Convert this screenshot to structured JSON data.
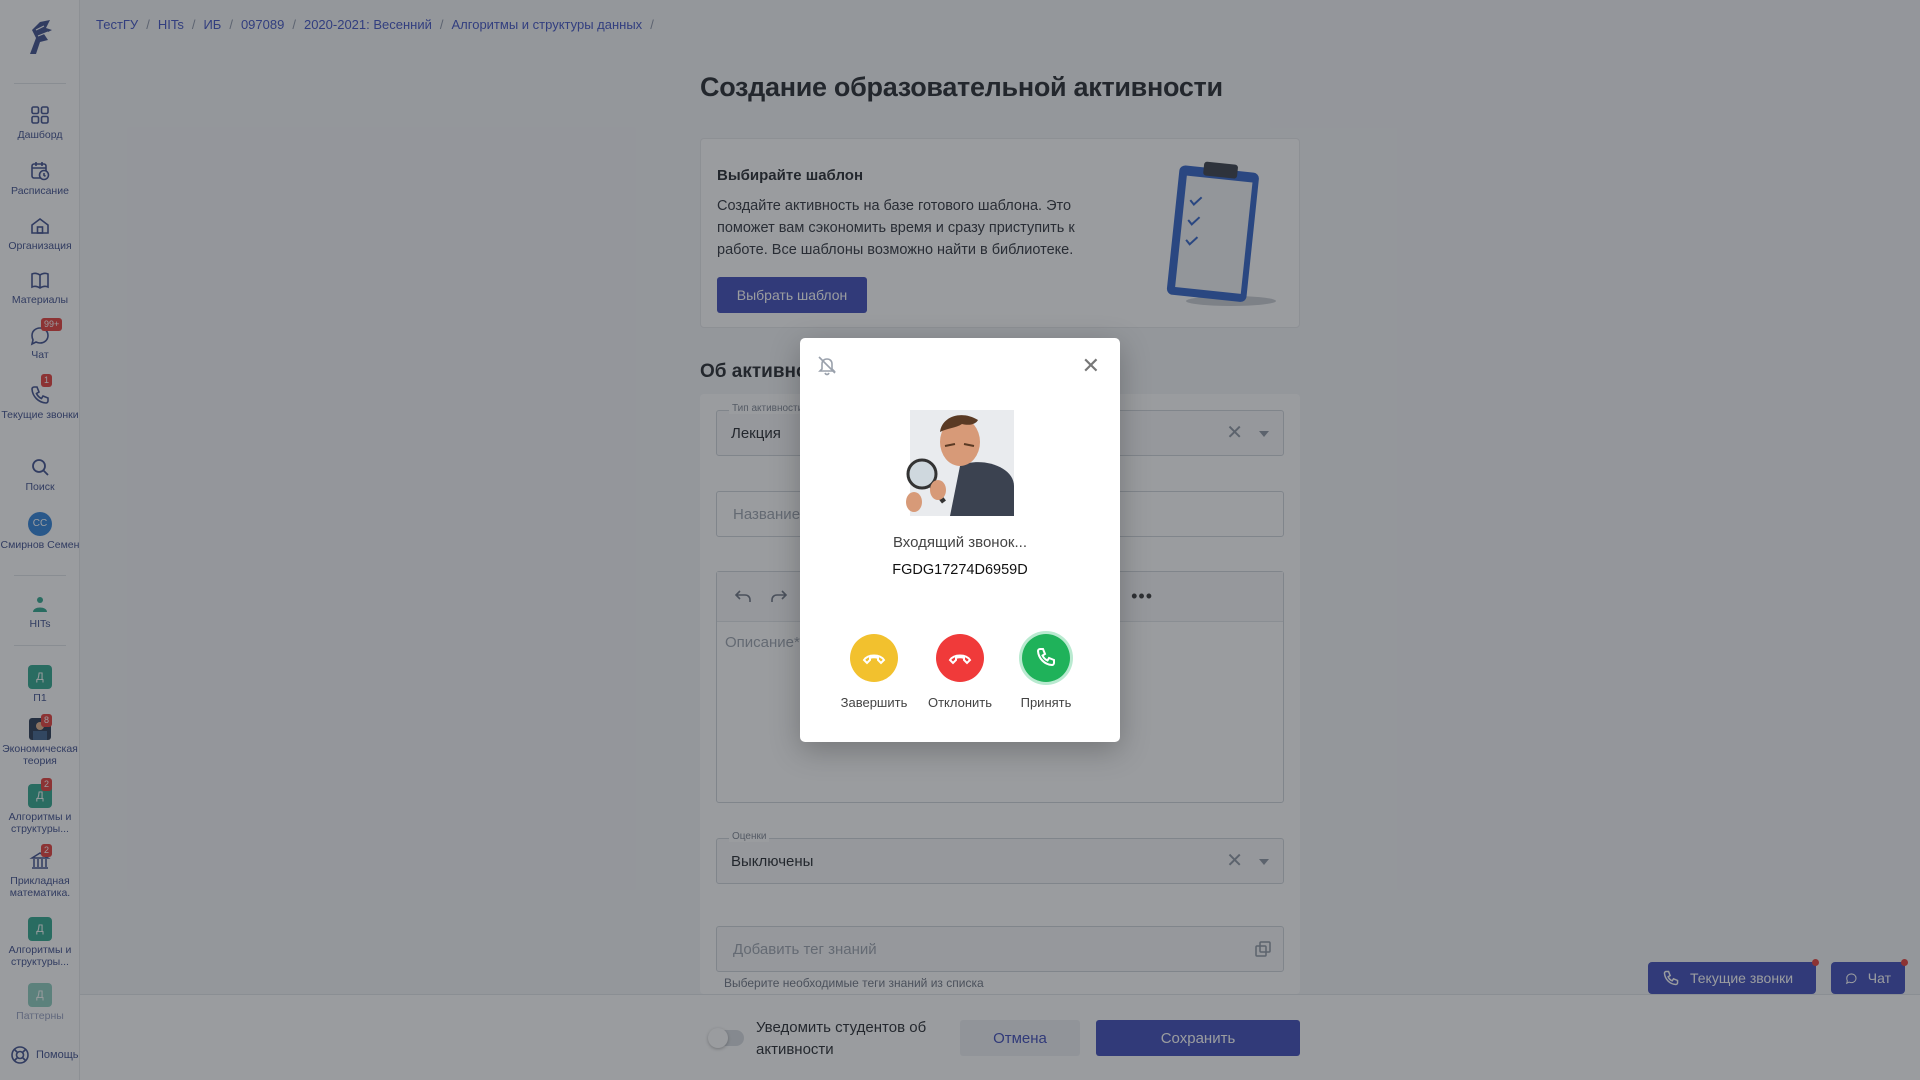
{
  "breadcrumb": [
    "ТестГУ",
    "HITs",
    "ИБ",
    "097089",
    "2020-2021: Весенний",
    "Алгоритмы и структуры данных"
  ],
  "sidebar": {
    "nav": [
      {
        "label": "Дашборд",
        "icon": "grid-icon"
      },
      {
        "label": "Расписание",
        "icon": "calendar-clock-icon"
      },
      {
        "label": "Организация",
        "icon": "building-icon"
      },
      {
        "label": "Материалы",
        "icon": "book-icon"
      },
      {
        "label": "Чат",
        "icon": "chat-icon",
        "badge": "99+"
      },
      {
        "label": "Текущие звонки",
        "icon": "phone-icon",
        "badge": "1"
      },
      {
        "label": "Поиск",
        "icon": "search-icon"
      }
    ],
    "user": {
      "initials": "СС",
      "name": "Смирнов Семен"
    },
    "org": {
      "label": "HITs"
    },
    "courses": [
      {
        "label": "П1",
        "letter": "Д"
      },
      {
        "label": "Экономическая теория",
        "badge": "8"
      },
      {
        "label": "Алгоритмы и структуры...",
        "letter": "Д",
        "badge": "2"
      },
      {
        "label": "Прикладная математика.",
        "badge": "2"
      },
      {
        "label": "Алгоритмы и структуры...",
        "letter": "Д"
      },
      {
        "label": "Паттерны",
        "letter": "Д"
      }
    ],
    "help": "Помощь"
  },
  "page": {
    "title": "Создание образовательной активности",
    "template_card": {
      "heading": "Выбирайте шаблон",
      "text": "Создайте активность на базе готового шаблона. Это поможет вам сэкономить время и сразу приступить к работе. Все шаблоны возможно найти в библиотеке.",
      "button": "Выбрать шаблон"
    },
    "section_heading": "Об активности",
    "type_field": {
      "label": "Тип активности",
      "value": "Лекция"
    },
    "name_field": {
      "placeholder": "Название*"
    },
    "description": {
      "placeholder": "Описание*"
    },
    "grades_field": {
      "label": "Оценки",
      "value": "Выключены"
    },
    "tags_field": {
      "placeholder": "Добавить тег знаний",
      "hint": "Выберите необходимые теги знаний из списка"
    }
  },
  "footer": {
    "notify_label": "Уведомить студентов об активности",
    "cancel": "Отмена",
    "save": "Сохранить"
  },
  "floating": {
    "calls": "Текущие звонки",
    "chat": "Чат"
  },
  "call_modal": {
    "status": "Входящий звонок...",
    "caller": "FGDG17274D6959D",
    "buttons": [
      {
        "label": "Завершить",
        "color": "#f2c12e"
      },
      {
        "label": "Отклонить",
        "color": "#f03a3a"
      },
      {
        "label": "Принять",
        "color": "#1fb25a"
      }
    ]
  },
  "colors": {
    "accent": "#3947b8",
    "sidebar_text": "#3a4a8a"
  }
}
